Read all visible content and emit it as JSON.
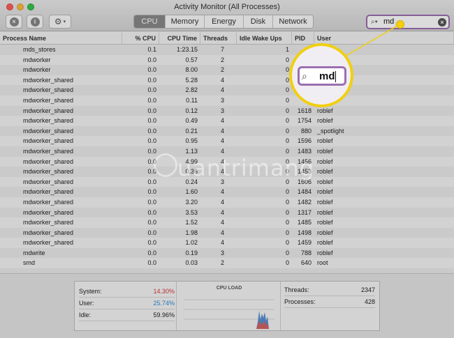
{
  "window": {
    "title": "Activity Monitor (All Processes)"
  },
  "toolbar": {
    "quit_icon": "x-circle-icon",
    "info_icon": "info-icon",
    "gear_icon": "gear-icon"
  },
  "tabs": [
    {
      "label": "CPU",
      "active": true
    },
    {
      "label": "Memory",
      "active": false
    },
    {
      "label": "Energy",
      "active": false
    },
    {
      "label": "Disk",
      "active": false
    },
    {
      "label": "Network",
      "active": false
    }
  ],
  "search": {
    "value": "md"
  },
  "table": {
    "headers": {
      "name": "Process Name",
      "cpu": "% CPU",
      "time": "CPU Time",
      "threads": "Threads",
      "wake": "Idle Wake Ups",
      "pid": "PID",
      "user": "User"
    },
    "rows": [
      {
        "name": "mds_stores",
        "cpu": "0.1",
        "time": "1:23.15",
        "threads": "7",
        "wake": "1",
        "pid": "",
        "user": ""
      },
      {
        "name": "mdworker",
        "cpu": "0.0",
        "time": "0.57",
        "threads": "2",
        "wake": "0",
        "pid": "",
        "user": ""
      },
      {
        "name": "mdworker",
        "cpu": "0.0",
        "time": "8.00",
        "threads": "2",
        "wake": "0",
        "pid": "",
        "user": ""
      },
      {
        "name": "mdworker_shared",
        "cpu": "0.0",
        "time": "5.28",
        "threads": "4",
        "wake": "0",
        "pid": "",
        "user": ""
      },
      {
        "name": "mdworker_shared",
        "cpu": "0.0",
        "time": "2.82",
        "threads": "4",
        "wake": "0",
        "pid": "",
        "user": ""
      },
      {
        "name": "mdworker_shared",
        "cpu": "0.0",
        "time": "0.11",
        "threads": "3",
        "wake": "0",
        "pid": "",
        "user": ""
      },
      {
        "name": "mdworker_shared",
        "cpu": "0.0",
        "time": "0.12",
        "threads": "3",
        "wake": "0",
        "pid": "1618",
        "user": "roblef"
      },
      {
        "name": "mdworker_shared",
        "cpu": "0.0",
        "time": "0.49",
        "threads": "4",
        "wake": "0",
        "pid": "1754",
        "user": "roblef"
      },
      {
        "name": "mdworker_shared",
        "cpu": "0.0",
        "time": "0.21",
        "threads": "4",
        "wake": "0",
        "pid": "880",
        "user": "_spotlight"
      },
      {
        "name": "mdworker_shared",
        "cpu": "0.0",
        "time": "0.95",
        "threads": "4",
        "wake": "0",
        "pid": "1596",
        "user": "roblef"
      },
      {
        "name": "mdworker_shared",
        "cpu": "0.0",
        "time": "1.13",
        "threads": "4",
        "wake": "0",
        "pid": "1483",
        "user": "roblef"
      },
      {
        "name": "mdworker_shared",
        "cpu": "0.0",
        "time": "4.99",
        "threads": "4",
        "wake": "0",
        "pid": "1456",
        "user": "roblef"
      },
      {
        "name": "mdworker_shared",
        "cpu": "0.0",
        "time": "0.36",
        "threads": "4",
        "wake": "0",
        "pid": "1453",
        "user": "roblef"
      },
      {
        "name": "mdworker_shared",
        "cpu": "0.0",
        "time": "0.24",
        "threads": "3",
        "wake": "0",
        "pid": "1606",
        "user": "roblef"
      },
      {
        "name": "mdworker_shared",
        "cpu": "0.0",
        "time": "1.60",
        "threads": "4",
        "wake": "0",
        "pid": "1484",
        "user": "roblef"
      },
      {
        "name": "mdworker_shared",
        "cpu": "0.0",
        "time": "3.20",
        "threads": "4",
        "wake": "0",
        "pid": "1482",
        "user": "roblef"
      },
      {
        "name": "mdworker_shared",
        "cpu": "0.0",
        "time": "3.53",
        "threads": "4",
        "wake": "0",
        "pid": "1317",
        "user": "roblef"
      },
      {
        "name": "mdworker_shared",
        "cpu": "0.0",
        "time": "1.52",
        "threads": "4",
        "wake": "0",
        "pid": "1485",
        "user": "roblef"
      },
      {
        "name": "mdworker_shared",
        "cpu": "0.0",
        "time": "1.98",
        "threads": "4",
        "wake": "0",
        "pid": "1498",
        "user": "roblef"
      },
      {
        "name": "mdworker_shared",
        "cpu": "0.0",
        "time": "1.02",
        "threads": "4",
        "wake": "0",
        "pid": "1459",
        "user": "roblef"
      },
      {
        "name": "mdwrite",
        "cpu": "0.0",
        "time": "0.19",
        "threads": "3",
        "wake": "0",
        "pid": "788",
        "user": "roblef"
      },
      {
        "name": "smd",
        "cpu": "0.0",
        "time": "0.03",
        "threads": "2",
        "wake": "0",
        "pid": "640",
        "user": "root"
      }
    ]
  },
  "stats": {
    "system_label": "System:",
    "system_value": "14.30%",
    "user_label": "User:",
    "user_value": "25.74%",
    "idle_label": "Idle:",
    "idle_value": "59.96%",
    "cpu_load_title": "CPU LOAD",
    "threads_label": "Threads:",
    "threads_value": "2347",
    "processes_label": "Processes:",
    "processes_value": "428"
  },
  "callout": {
    "magnified_text": "md"
  },
  "colors": {
    "system": "#d63a3a",
    "user": "#2f8bd6",
    "search_border": "#9b6fb0",
    "callout": "#f0cf10"
  },
  "watermark": {
    "text": "uantrimang"
  }
}
